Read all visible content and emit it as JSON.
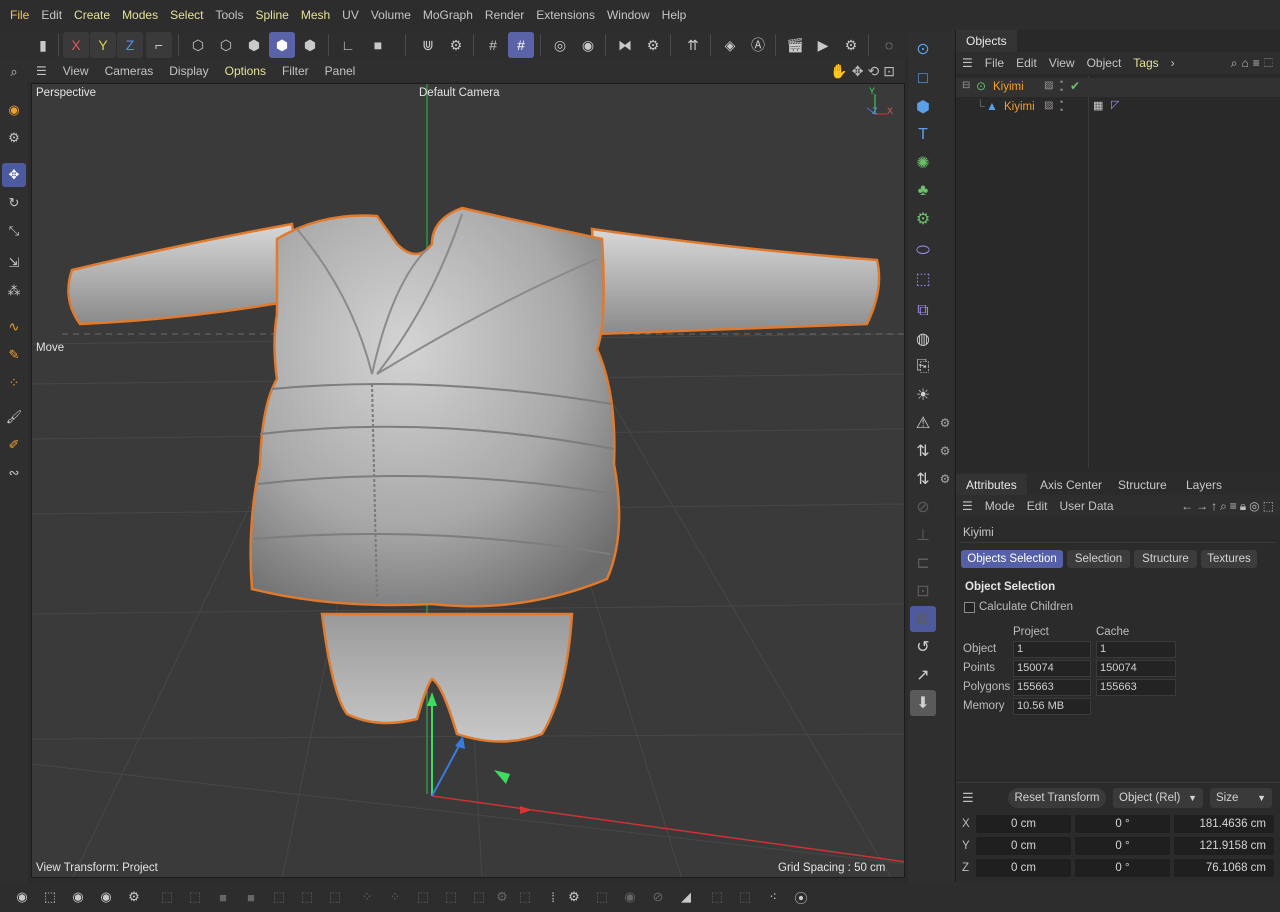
{
  "menu": [
    "File",
    "Edit",
    "Create",
    "Modes",
    "Select",
    "Tools",
    "Spline",
    "Mesh",
    "UV",
    "Volume",
    "MoGraph",
    "Render",
    "Extensions",
    "Window",
    "Help"
  ],
  "toolbar": {
    "axes": [
      "X",
      "Y",
      "Z"
    ]
  },
  "viewport_menu": [
    "View",
    "Cameras",
    "Display",
    "Options",
    "Filter",
    "Panel"
  ],
  "viewport": {
    "projection": "Perspective",
    "camera": "Default Camera",
    "tool_label": "Move",
    "view_transform": "View Transform: Project",
    "grid_spacing": "Grid Spacing : 50 cm",
    "axis_y": "Y",
    "axis_z": "Z",
    "axis_x": "X"
  },
  "objects_panel": {
    "tab": "Objects",
    "menu": [
      "File",
      "Edit",
      "View",
      "Object",
      "Tags"
    ],
    "items": [
      {
        "name": "Kiyimi",
        "level": 0
      },
      {
        "name": "Kiyimi",
        "level": 1
      }
    ]
  },
  "attributes": {
    "tabs": [
      "Attributes",
      "Axis Center",
      "Structure",
      "Layers"
    ],
    "menu": [
      "Mode",
      "Edit",
      "User Data"
    ],
    "object_name": "Kiyimi",
    "subtabs": [
      "Objects Selection",
      "Selection",
      "Structure",
      "Textures"
    ],
    "section_title": "Object Selection",
    "checkbox_label": "Calculate Children",
    "columns": [
      "Project",
      "Cache"
    ],
    "rows": [
      {
        "label": "Object",
        "project": "1",
        "cache": "1"
      },
      {
        "label": "Points",
        "project": "150074",
        "cache": "150074"
      },
      {
        "label": "Polygons",
        "project": "155663",
        "cache": "155663"
      },
      {
        "label": "Memory",
        "project": "10.56 MB",
        "cache": ""
      }
    ]
  },
  "transform": {
    "reset_label": "Reset Transform",
    "mode": "Object (Rel)",
    "size_mode": "Size",
    "rows": [
      {
        "axis": "X",
        "pos": "0 cm",
        "rot": "0 °",
        "size": "181.4636 cm"
      },
      {
        "axis": "Y",
        "pos": "0 cm",
        "rot": "0 °",
        "size": "121.9158 cm"
      },
      {
        "axis": "Z",
        "pos": "0 cm",
        "rot": "0 °",
        "size": "76.1068 cm"
      }
    ]
  },
  "colors": {
    "accent": "#5560a8",
    "highlight_menu": "#e6e19a",
    "object_name": "#f0a030",
    "selection_outline": "#e07a2e"
  }
}
